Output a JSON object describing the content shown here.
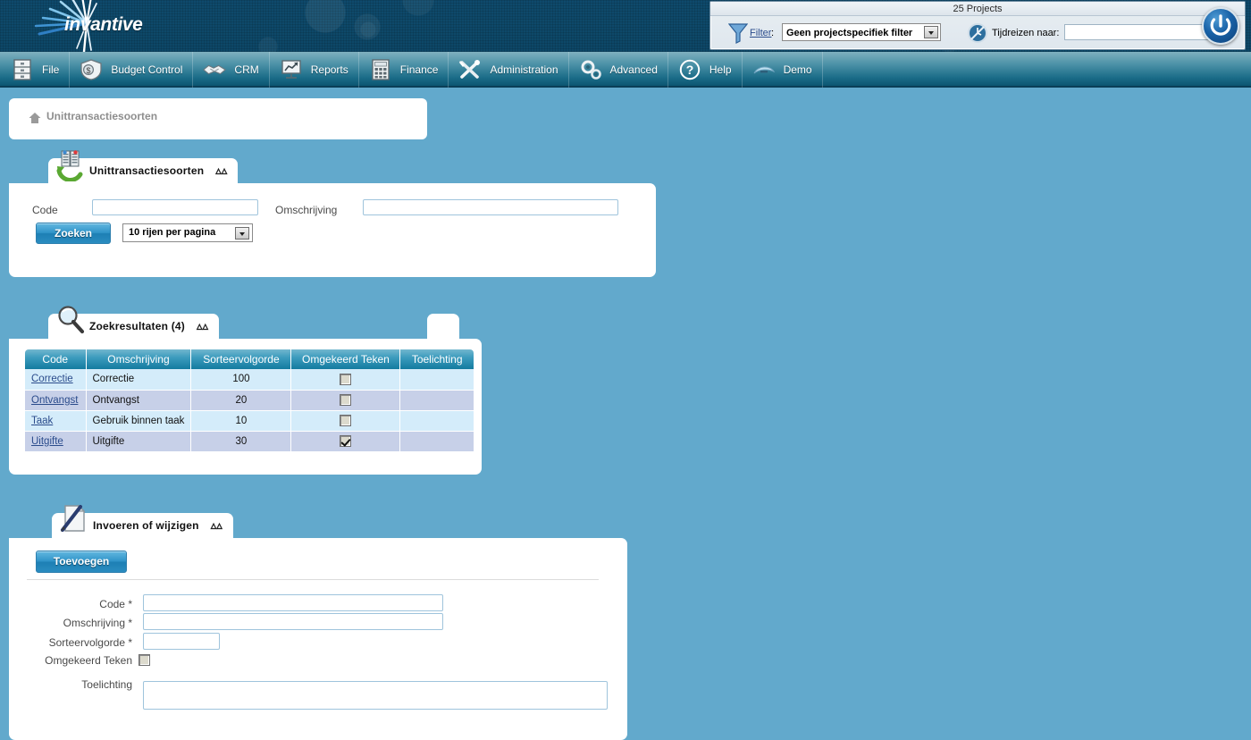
{
  "brand": {
    "name": "invantive",
    "logo_icon": "burst-logo"
  },
  "topbar": {
    "title": "25 Projects",
    "filter_icon": "funnel-icon",
    "filter_label": "Filter",
    "filter_colon": ":",
    "filter_value": "Geen projectspecifiek filter",
    "clock_icon": "time-travel-clock-icon",
    "timetravel_label": "Tijdreizen naar:",
    "timetravel_value": "",
    "power_icon": "power-icon"
  },
  "menu": {
    "items": [
      {
        "label": "File",
        "icon": "cabinet-icon"
      },
      {
        "label": "Budget Control",
        "icon": "money-shield-icon"
      },
      {
        "label": "CRM",
        "icon": "handshake-icon"
      },
      {
        "label": "Reports",
        "icon": "presentation-chart-icon"
      },
      {
        "label": "Finance",
        "icon": "calculator-icon"
      },
      {
        "label": "Administration",
        "icon": "tools-icon"
      },
      {
        "label": "Advanced",
        "icon": "gears-icon"
      },
      {
        "label": "Help",
        "icon": "question-circle-icon"
      },
      {
        "label": "Demo",
        "icon": "fan-icon"
      }
    ]
  },
  "breadcrumb": {
    "home_icon": "home-icon",
    "text": "Unittransactiesoorten"
  },
  "search_panel": {
    "tab_title": "Unittransactiesoorten",
    "tab_icon": "recycle-data-icon",
    "collapse_icon": "chevron-up-icon",
    "code_label": "Code",
    "code_value": "",
    "omschrijving_label": "Omschrijving",
    "omschrijving_value": "",
    "search_button": "Zoeken",
    "rows_per_page": "10 rijen per pagina"
  },
  "results_panel": {
    "tab_title": "Zoekresultaten (4)",
    "tab_icon": "magnifier-icon",
    "collapse_icon": "chevron-up-icon",
    "columns": [
      "Code",
      "Omschrijving",
      "Sorteervolgorde",
      "Omgekeerd Teken",
      "Toelichting"
    ],
    "rows": [
      {
        "code": "Correctie",
        "omschrijving": "Correctie",
        "sorteervolgorde": "100",
        "omgekeerd_teken": false,
        "toelichting": ""
      },
      {
        "code": "Ontvangst",
        "omschrijving": "Ontvangst",
        "sorteervolgorde": "20",
        "omgekeerd_teken": false,
        "toelichting": ""
      },
      {
        "code": "Taak",
        "omschrijving": "Gebruik binnen taak",
        "sorteervolgorde": "10",
        "omgekeerd_teken": false,
        "toelichting": ""
      },
      {
        "code": "Uitgifte",
        "omschrijving": "Uitgifte",
        "sorteervolgorde": "30",
        "omgekeerd_teken": true,
        "toelichting": ""
      }
    ]
  },
  "edit_panel": {
    "tab_title": "Invoeren of wijzigen",
    "tab_icon": "document-pen-icon",
    "collapse_icon": "chevron-up-icon",
    "add_button": "Toevoegen",
    "fields": {
      "code_label": "Code *",
      "code_value": "",
      "omschrijving_label": "Omschrijving *",
      "omschrijving_value": "",
      "sorteervolgorde_label": "Sorteervolgorde *",
      "sorteervolgorde_value": "",
      "omgekeerd_label": "Omgekeerd Teken",
      "omgekeerd_checked": false,
      "toelichting_label": "Toelichting",
      "toelichting_value": ""
    }
  },
  "colors": {
    "page_bg": "#62a9cc",
    "banner": "#0d4a6b",
    "accent": "#1d7fb4",
    "grid_header": "#137b9f",
    "row_odd": "#d4ecfa",
    "row_even": "#c7d0e8",
    "link": "#2b4c8c"
  }
}
